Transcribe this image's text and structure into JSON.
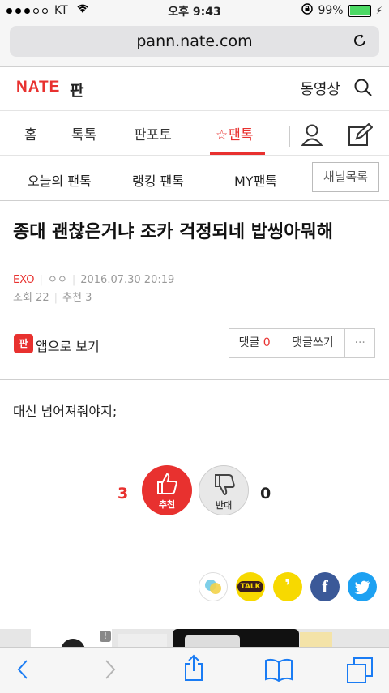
{
  "status_bar": {
    "carrier": "KT",
    "time": "오후 9:43",
    "battery": "99%"
  },
  "browser": {
    "url": "pann.nate.com"
  },
  "header": {
    "brand": "NATE",
    "brand_sub": "판",
    "video": "동영상"
  },
  "main_nav": {
    "items": [
      "홈",
      "톡톡",
      "판포토",
      "팬톡"
    ],
    "active": "팬톡"
  },
  "sub_nav": {
    "items": [
      "오늘의 팬톡",
      "랭킹 팬톡",
      "MY팬톡"
    ],
    "channel_list": "채널목록"
  },
  "post": {
    "title": "종대 괜찮은거냐 조카 걱정되네 밥씽아뭐해",
    "category": "EXO",
    "author": "ㅇㅇ",
    "datetime": "2016.07.30 20:19",
    "views_label": "조회",
    "views": "22",
    "recommend_label": "추천",
    "recommend": "3",
    "content": "대신 넘어져줘야지;"
  },
  "app_view": {
    "icon_text": "판",
    "label": "앱으로 보기"
  },
  "actions": {
    "comments_label": "댓글",
    "comments_count": "0",
    "write_comment": "댓글쓰기",
    "more": "···"
  },
  "votes": {
    "up_label": "추천",
    "up_count": "3",
    "down_label": "반대",
    "down_count": "0"
  },
  "share": {
    "talk": "TALK",
    "story": "❜",
    "facebook": "f"
  },
  "ad": {
    "badge": "!"
  },
  "colors": {
    "accent": "#e8312f",
    "kakao": "#f7d900",
    "facebook": "#3b5998",
    "twitter": "#1da1f2",
    "ios_blue": "#1a7cf4"
  }
}
